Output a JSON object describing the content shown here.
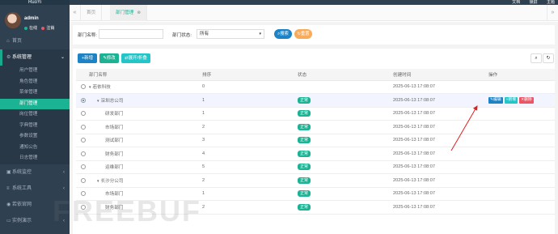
{
  "sidebar": {
    "brand": "RuoYi",
    "user": {
      "name": "admin",
      "status_online": "在线",
      "status_logout": "注销"
    },
    "items": [
      {
        "label": "首页",
        "icon": "home-icon"
      },
      {
        "label": "系统管理",
        "icon": "gear-icon"
      },
      {
        "label": "系统监控",
        "icon": "video-icon"
      },
      {
        "label": "系统工具",
        "icon": "bars-icon"
      },
      {
        "label": "若依官网",
        "icon": "location-icon"
      },
      {
        "label": "实例演示",
        "icon": "desktop-icon"
      }
    ],
    "subitems": [
      "用户管理",
      "角色管理",
      "菜单管理",
      "部门管理",
      "岗位管理",
      "字典管理",
      "参数设置",
      "通知公告",
      "日志管理"
    ]
  },
  "topbar": {
    "doc": "文档",
    "fullscreen": "锁屏",
    "theme": "主题"
  },
  "tabs": {
    "home": "首页",
    "dept": "部门管理"
  },
  "search": {
    "name_label": "部门名称:",
    "status_label": "部门状态:",
    "status_value": "所有",
    "search_btn": "搜索",
    "reset_btn": "重置"
  },
  "toolbar": {
    "add": "新增",
    "edit": "修改",
    "expand": "展开/折叠"
  },
  "table": {
    "headers": [
      "部门名称",
      "排序",
      "状态",
      "创建时间",
      "操作"
    ],
    "rows": [
      {
        "name": "若依科技",
        "order": "0",
        "status": "",
        "time": "2025-06-13 17:08:07",
        "actions": false
      },
      {
        "name": "深圳总公司",
        "order": "1",
        "status": "正常",
        "time": "2025-06-13 17:08:07",
        "actions": true
      },
      {
        "name": "研发部门",
        "order": "1",
        "status": "正常",
        "time": "2025-06-13 17:08:07",
        "actions": false
      },
      {
        "name": "市场部门",
        "order": "2",
        "status": "正常",
        "time": "2025-06-13 17:08:07",
        "actions": false
      },
      {
        "name": "测试部门",
        "order": "3",
        "status": "正常",
        "time": "2025-06-13 17:08:07",
        "actions": false
      },
      {
        "name": "财务部门",
        "order": "4",
        "status": "正常",
        "time": "2025-06-13 17:08:07",
        "actions": false
      },
      {
        "name": "运维部门",
        "order": "5",
        "status": "正常",
        "time": "2025-06-13 17:08:07",
        "actions": false
      },
      {
        "name": "长沙分公司",
        "order": "2",
        "status": "正常",
        "time": "2025-06-13 17:08:07",
        "actions": false
      },
      {
        "name": "市场部门",
        "order": "1",
        "status": "正常",
        "time": "2025-06-13 17:08:07",
        "actions": false
      },
      {
        "name": "财务部门",
        "order": "2",
        "status": "正常",
        "time": "2025-06-13 17:08:07",
        "actions": false
      }
    ],
    "action_labels": {
      "edit": "编辑",
      "add": "新增",
      "delete": "删除"
    }
  },
  "watermark": "FREEBUF",
  "colors": {
    "sidebar": "#2f4050",
    "accent": "#1ab394",
    "primary": "#1c84c6",
    "danger": "#ed5565",
    "warning": "#f8ac59"
  }
}
